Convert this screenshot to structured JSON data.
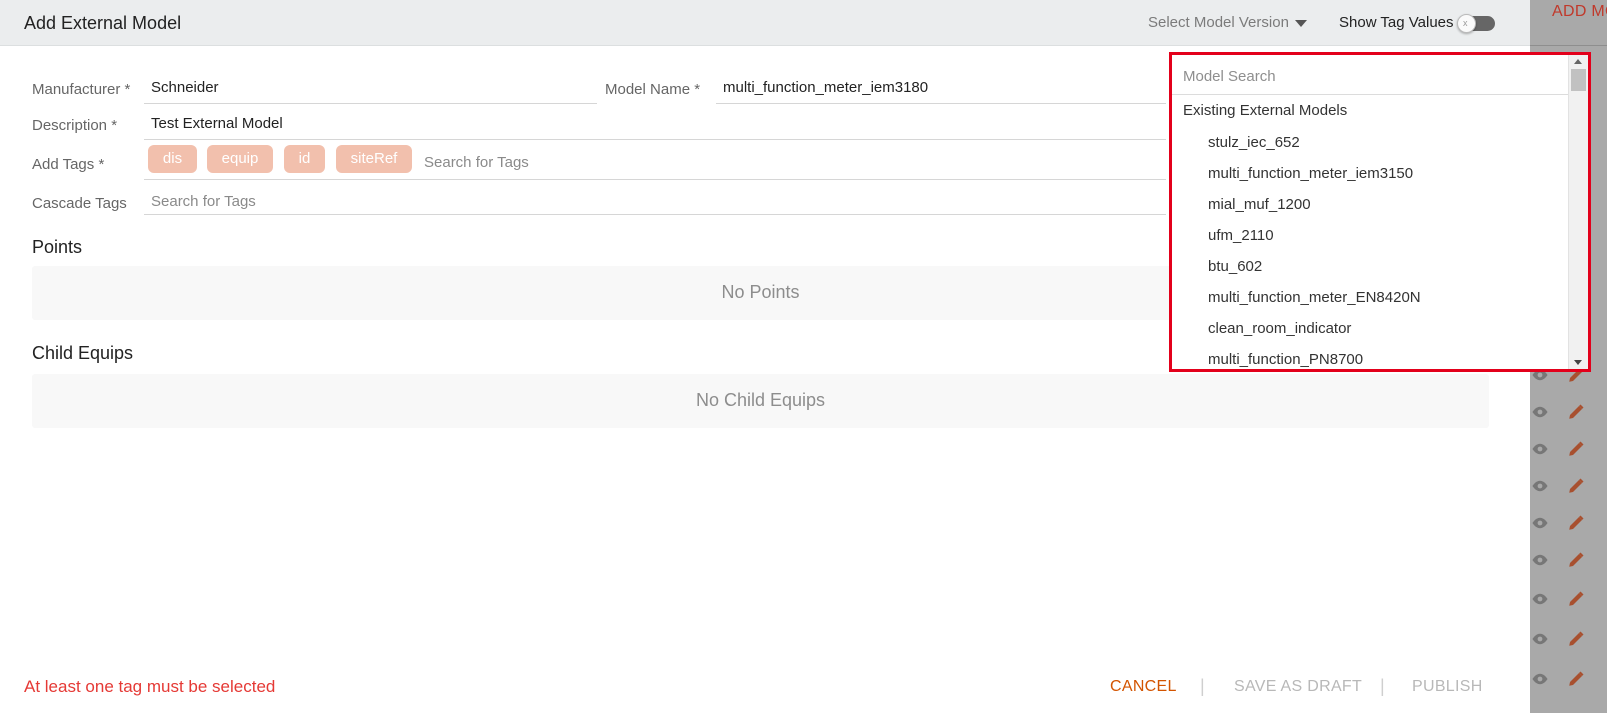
{
  "background": {
    "add_button_label": "ADD MODEL"
  },
  "modal": {
    "title": "Add External Model",
    "version_select_label": "Select Model Version",
    "show_tag_values_label": "Show Tag Values",
    "show_tag_values_on": false,
    "toggle_off_glyph": "x"
  },
  "form": {
    "manufacturer_label": "Manufacturer *",
    "manufacturer_value": "Schneider",
    "model_name_label": "Model Name *",
    "model_name_value": "multi_function_meter_iem3180",
    "description_label": "Description *",
    "description_value": "Test External Model",
    "add_tags_label": "Add Tags *",
    "tags": [
      "dis",
      "equip",
      "id",
      "siteRef"
    ],
    "tag_search_placeholder": "Search for Tags",
    "cascade_tags_label": "Cascade Tags",
    "cascade_search_placeholder": "Search for Tags"
  },
  "points": {
    "title": "Points",
    "empty_text": "No Points"
  },
  "child_equips": {
    "title": "Child Equips",
    "empty_text": "No Child Equips"
  },
  "footer": {
    "error": "At least one tag must be selected",
    "cancel_label": "CANCEL",
    "save_draft_label": "SAVE AS DRAFT",
    "publish_label": "PUBLISH",
    "separator": "|"
  },
  "model_dropdown": {
    "search_placeholder": "Model Search",
    "group_label": "Existing External Models",
    "items": [
      "stulz_iec_652",
      "multi_function_meter_iem3150",
      "mial_muf_1200",
      "ufm_2110",
      "btu_602",
      "multi_function_meter_EN8420N",
      "clean_room_indicator",
      "multi_function_PN8700"
    ]
  },
  "colors": {
    "accent": "#d35400",
    "error": "#e53935",
    "chip": "#f2c0ad",
    "highlight_border": "#e3001b"
  }
}
